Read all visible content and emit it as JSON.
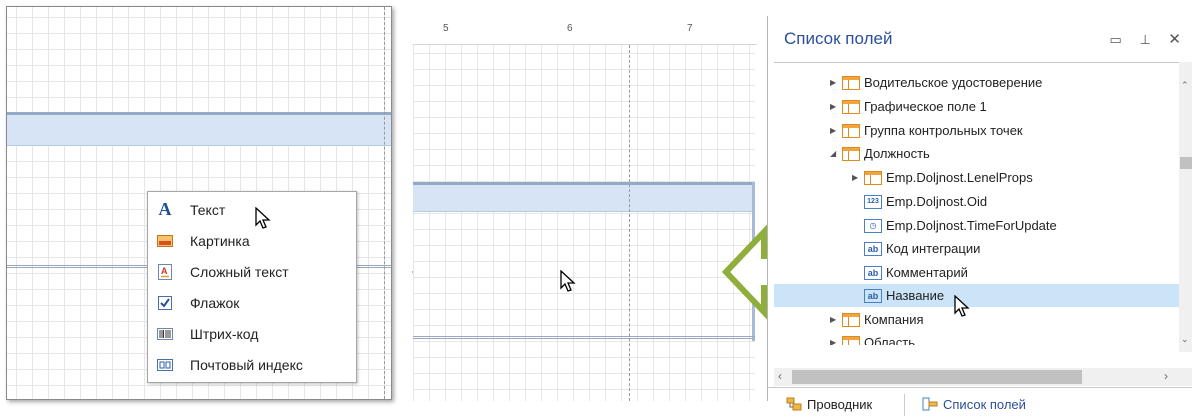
{
  "ruler": [
    "5",
    "6",
    "7"
  ],
  "toolbox": [
    {
      "label": "Текст",
      "icon": "text-icon"
    },
    {
      "label": "Картинка",
      "icon": "picture-icon"
    },
    {
      "label": "Сложный текст",
      "icon": "rich-text-icon"
    },
    {
      "label": "Флажок",
      "icon": "checkbox-icon"
    },
    {
      "label": "Штрих-код",
      "icon": "barcode-icon"
    },
    {
      "label": "Почтовый индекс",
      "icon": "zipcode-icon"
    }
  ],
  "field_list": {
    "title": "Список полей",
    "items": [
      {
        "label": "Водительское удостоверение",
        "icon": "table-icon",
        "expander": "collapsed"
      },
      {
        "label": "Графическое поле 1",
        "icon": "table-icon",
        "expander": "collapsed"
      },
      {
        "label": "Группа контрольных точек",
        "icon": "table-icon",
        "expander": "collapsed"
      },
      {
        "label": "Должность",
        "icon": "table-icon",
        "expander": "expanded"
      },
      {
        "label": "Emp.Doljnost.LenelProps",
        "icon": "table-icon",
        "expander": "collapsed"
      },
      {
        "label": "Emp.Doljnost.Oid",
        "icon": "number-field-icon",
        "expander": "none"
      },
      {
        "label": "Emp.Doljnost.TimeForUpdate",
        "icon": "clock-field-icon",
        "expander": "none"
      },
      {
        "label": "Код интеграции",
        "icon": "string-field-icon",
        "expander": "none"
      },
      {
        "label": "Комментарий",
        "icon": "string-field-icon",
        "expander": "none"
      },
      {
        "label": "Название",
        "icon": "string-field-icon",
        "expander": "none",
        "selected": true
      },
      {
        "label": "Компания",
        "icon": "table-icon",
        "expander": "collapsed"
      },
      {
        "label": "Область",
        "icon": "table-icon",
        "expander": "collapsed"
      }
    ],
    "tabs": [
      {
        "label": "Проводник",
        "icon": "explorer-icon"
      },
      {
        "label": "Список полей",
        "icon": "field-list-icon"
      }
    ]
  },
  "colors": {
    "arrow": "#8fae3c",
    "title": "#2b4f9a",
    "band": "#d6e4f5",
    "selected": "#cce4f7"
  }
}
